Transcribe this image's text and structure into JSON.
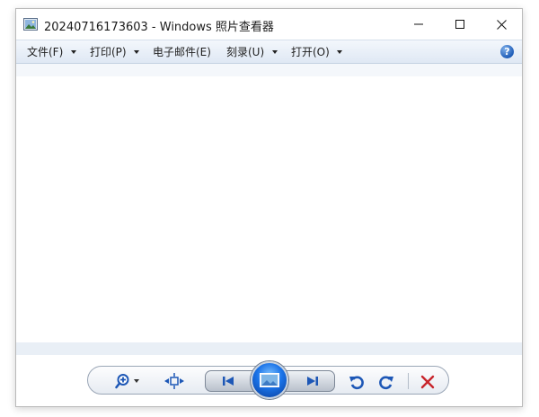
{
  "window": {
    "title": "20240716173603 - Windows 照片查看器"
  },
  "menu": {
    "file": "文件(F)",
    "print": "打印(P)",
    "email": "电子邮件(E)",
    "burn": "刻录(U)",
    "open": "打开(O)"
  },
  "icons": {
    "app": "photo-viewer-icon",
    "minimize": "minimize-icon",
    "maximize": "maximize-icon",
    "close": "close-icon",
    "help": "help-icon",
    "zoom": "zoom-icon",
    "fit": "fit-to-window-icon",
    "previous": "previous-icon",
    "slideshow": "slideshow-icon",
    "next": "next-icon",
    "rotate_ccw": "rotate-counterclockwise-icon",
    "rotate_cw": "rotate-clockwise-icon",
    "delete": "delete-icon"
  },
  "help_glyph": "?",
  "colors": {
    "menubar": "#dfe8f4",
    "accent": "#1a73e8",
    "delete": "#c8252c",
    "rotate": "#1d57b6"
  }
}
